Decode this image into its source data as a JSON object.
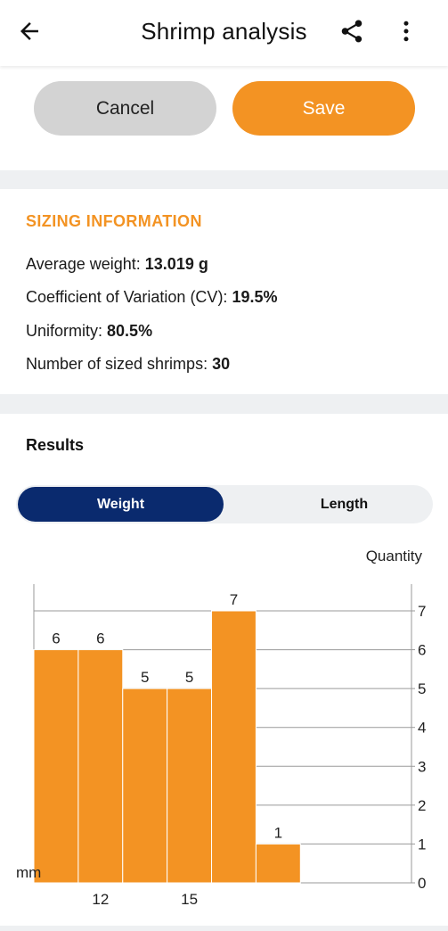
{
  "appbar": {
    "title": "Shrimp analysis"
  },
  "actions": {
    "cancel_label": "Cancel",
    "save_label": "Save"
  },
  "sizing": {
    "section_title": "SIZING INFORMATION",
    "rows": [
      {
        "label": "Average weight:",
        "value": "13.019 g"
      },
      {
        "label": "Coefficient of Variation (CV):",
        "value": "19.5%"
      },
      {
        "label": "Uniformity:",
        "value": "80.5%"
      },
      {
        "label": "Number of sized shrimps:",
        "value": "30"
      }
    ]
  },
  "results": {
    "title": "Results",
    "tabs": [
      {
        "label": "Weight",
        "active": true
      },
      {
        "label": "Length",
        "active": false
      }
    ]
  },
  "colors": {
    "accent": "#f39323",
    "primary": "#0a2a6e",
    "toggle_bg": "#eef0f2",
    "cancel_bg": "#d3d3d3"
  },
  "chart_data": {
    "type": "bar",
    "ylabel": "Quantity",
    "xlabel": "mm",
    "ylim": [
      0,
      7
    ],
    "yticks": [
      0,
      1,
      2,
      3,
      4,
      5,
      6,
      7
    ],
    "xlim": [
      9.5,
      18
    ],
    "bins": [
      {
        "x0": 9.5,
        "x1": 10.5,
        "value": 6
      },
      {
        "x0": 10.5,
        "x1": 11.5,
        "value": 6
      },
      {
        "x0": 11.5,
        "x1": 12.5,
        "value": 5
      },
      {
        "x0": 12.5,
        "x1": 13.5,
        "value": 5
      },
      {
        "x0": 13.5,
        "x1": 14.5,
        "value": 7
      },
      {
        "x0": 14.5,
        "x1": 15.5,
        "value": 1
      }
    ],
    "xtick_labels": [
      {
        "value": 11,
        "label": "12"
      },
      {
        "value": 13,
        "label": "15"
      }
    ],
    "grid": true
  }
}
